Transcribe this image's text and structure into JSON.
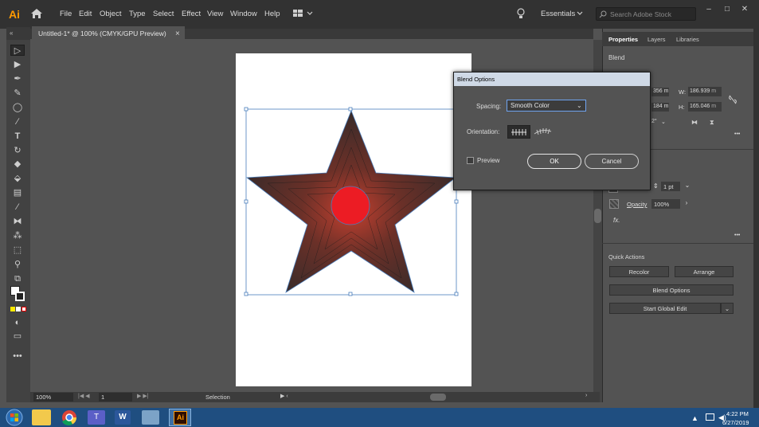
{
  "app": {
    "logo": "Ai",
    "workspace": "Essentials",
    "search_placeholder": "Search Adobe Stock"
  },
  "menu": [
    "File",
    "Edit",
    "Object",
    "Type",
    "Select",
    "Effect",
    "View",
    "Window",
    "Help"
  ],
  "document": {
    "tab_title": "Untitled-1* @ 100% (CMYK/GPU Preview)",
    "close": "×"
  },
  "status": {
    "zoom": "100%",
    "artboard_num": "1",
    "tool": "Selection"
  },
  "panel": {
    "tabs": [
      "Properties",
      "Layers",
      "Libraries"
    ],
    "section_title": "Blend",
    "w_label": "W:",
    "w_value": "186.939 ",
    "h_label": "H:",
    "h_value": "165.046 ",
    "x_partial": "356 m",
    "y_partial": "184 m",
    "angle_partial": "2°",
    "stroke_value": "1 pt",
    "opacity_label": "Opacity",
    "opacity_value": "100%",
    "fx_label": "fx.",
    "quick_actions_title": "Quick Actions",
    "recolor": "Recolor",
    "arrange": "Arrange",
    "blend_options": "Blend Options",
    "start_global_edit": "Start Global Edit",
    "more": "•••"
  },
  "dialog": {
    "title": "Blend Options",
    "spacing_label": "Spacing:",
    "spacing_value": "Smooth Color",
    "orientation_label": "Orientation:",
    "preview_label": "Preview",
    "ok": "OK",
    "cancel": "Cancel"
  },
  "taskbar": {
    "time": "4:22 PM",
    "date": "6/27/2019"
  },
  "colors": {
    "accent_orange": "#ff9a00",
    "circle_red": "#ec1c24",
    "selection_blue": "#4a7ebb"
  }
}
